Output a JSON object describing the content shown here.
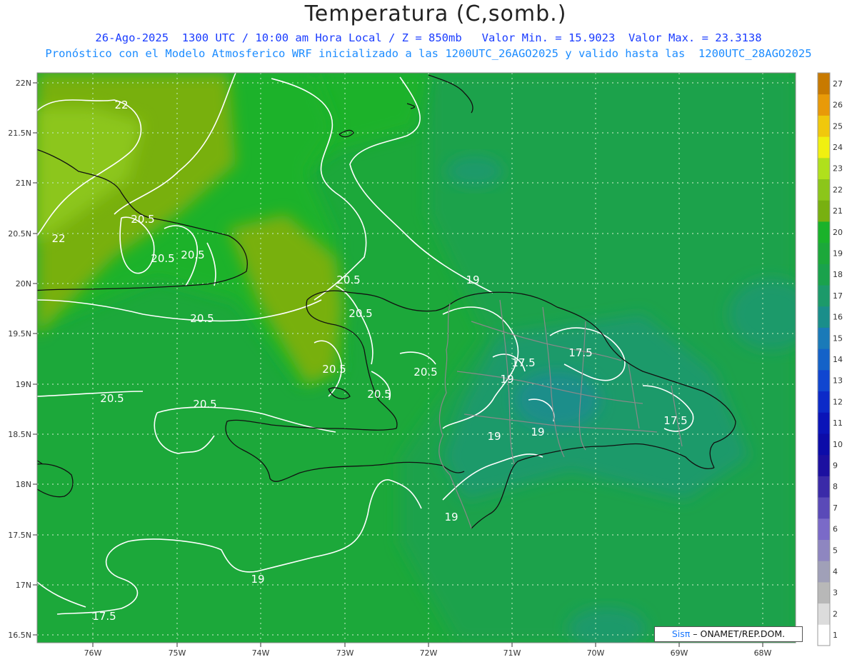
{
  "title": "Temperatura (C,somb.)",
  "subtitle_line1": "26-Ago-2025  1300 UTC / 10:00 am Hora Local / Z = 850mb   Valor Min. = 15.9023  Valor Max. = 23.3138",
  "subtitle_line2": "Pronóstico con el Modelo Atmosferico WRF inicializado a las 1200UTC_26AGO2025 y valido hasta las  1200UTC_28AGO2025",
  "axes": {
    "lat_ticks": [
      "22N",
      "21.5N",
      "21N",
      "20.5N",
      "20N",
      "19.5N",
      "19N",
      "18.5N",
      "18N",
      "17.5N",
      "17N",
      "16.5N"
    ],
    "lon_ticks": [
      "76W",
      "75W",
      "74W",
      "73W",
      "72W",
      "71W",
      "70W",
      "69W",
      "68W"
    ]
  },
  "colorbar": {
    "labels": [
      "1",
      "2",
      "3",
      "4",
      "5",
      "6",
      "7",
      "8",
      "9",
      "10",
      "11",
      "12",
      "13",
      "14",
      "15",
      "16",
      "17",
      "18",
      "19",
      "20",
      "21",
      "22",
      "23",
      "24",
      "25",
      "26",
      "27"
    ],
    "colors": [
      "#ffffff",
      "#dcdcdc",
      "#b8b8b8",
      "#a0a0b8",
      "#8e86c0",
      "#7a6ac8",
      "#5a4ab8",
      "#3a2aa8",
      "#1c10a0",
      "#0c0ca8",
      "#0a14b8",
      "#0c2ac8",
      "#1046d0",
      "#1462c8",
      "#1a7ab8",
      "#1a8e8a",
      "#1c9a6a",
      "#1aa24c",
      "#1ca83a",
      "#1ab22a",
      "#78b010",
      "#8cc61a",
      "#b0e01c",
      "#f0f010",
      "#f0c80c",
      "#e89a08",
      "#c87a00"
    ]
  },
  "contour_labels": [
    "22",
    "22",
    "20.5",
    "20.5",
    "20.5",
    "20.5",
    "20.5",
    "20.5",
    "20.5",
    "20.5",
    "20.5",
    "20.5",
    "20.5",
    "19",
    "19",
    "19",
    "19",
    "19",
    "19",
    "17.5",
    "17.5",
    "17.5",
    "17.5"
  ],
  "credit": {
    "brand": "Sisπ",
    "text": " – ONAMET/REP.DOM."
  }
}
